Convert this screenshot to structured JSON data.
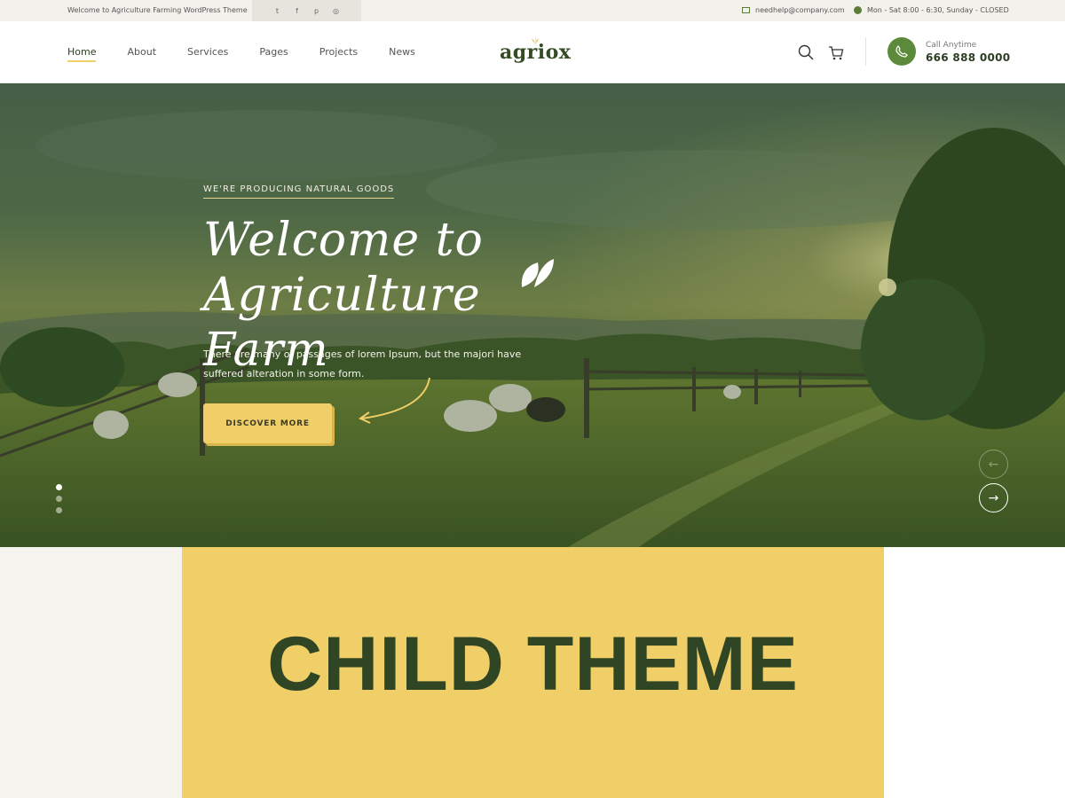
{
  "topbar": {
    "welcome": "Welcome to Agriculture Farming WordPress Theme",
    "socials": [
      "twitter-icon",
      "facebook-icon",
      "pinterest-icon",
      "instagram-icon"
    ],
    "social_glyphs": [
      "t",
      "f",
      "p",
      "◎"
    ],
    "email": "needhelp@company.com",
    "hours": "Mon - Sat 8:00 - 6:30, Sunday - CLOSED"
  },
  "header": {
    "nav": [
      "Home",
      "About",
      "Services",
      "Pages",
      "Projects",
      "News"
    ],
    "active_nav": "Home",
    "logo": "agriox",
    "call_label": "Call Anytime",
    "call_number": "666 888 0000"
  },
  "hero": {
    "eyebrow": "WE'RE PRODUCING NATURAL GOODS",
    "title_line1": "Welcome to",
    "title_line2": "Agriculture Farm",
    "description": "There are many of passages of lorem Ipsum, but the majori have suffered alteration in some form.",
    "cta": "DISCOVER MORE",
    "slides_total": 3,
    "active_slide": 1,
    "prev_arrow": "←",
    "next_arrow": "→"
  },
  "banner": {
    "text": "CHILD THEME"
  },
  "colors": {
    "accent_yellow": "#f0cf68",
    "brand_green": "#344b23",
    "phone_green": "#5b8a3a",
    "topbar_bg": "#f3f1ec"
  }
}
